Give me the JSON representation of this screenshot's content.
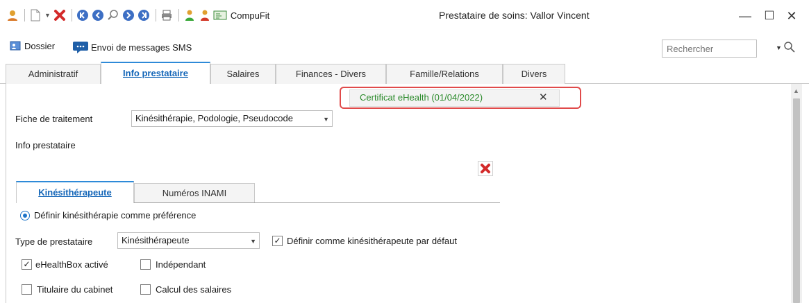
{
  "window": {
    "title": "Prestataire de soins: Vallor Vincent",
    "minimize": "—",
    "maximize": "☐",
    "close": "✕"
  },
  "toolbar": {
    "compufit_label": "CompuFit",
    "icons": [
      "person-search-icon",
      "new-document-icon",
      "delete-icon",
      "first-record-icon",
      "previous-record-icon",
      "search-icon",
      "next-record-icon",
      "last-record-icon",
      "print-icon",
      "person-green-icon",
      "person-red-icon",
      "compufit-icon"
    ]
  },
  "actions": {
    "dossier_label": "Dossier",
    "sms_label": "Envoi de messages SMS"
  },
  "search": {
    "placeholder": "Rechercher"
  },
  "tabs": [
    {
      "label": "Administratif"
    },
    {
      "label": "Info prestataire"
    },
    {
      "label": "Salaires"
    },
    {
      "label": "Finances - Divers"
    },
    {
      "label": "Famille/Relations"
    },
    {
      "label": "Divers"
    }
  ],
  "certificate": {
    "text": "Certificat eHealth (01/04/2022)",
    "close": "✕"
  },
  "form": {
    "fiche_label": "Fiche de traitement",
    "fiche_value": "Kinésithérapie, Podologie, Pseudocode",
    "info_label": "Info prestataire"
  },
  "subtabs": [
    {
      "label": "Kinésithérapeute"
    },
    {
      "label": "Numéros INAMI"
    }
  ],
  "kine": {
    "radio_label": "Définir kinésithérapie comme préférence",
    "type_label": "Type de prestataire",
    "type_value": "Kinésithérapeute",
    "default_label": "Définir comme kinésithérapeute par défaut",
    "default_checked": true,
    "ehealthbox_label": "eHealthBox activé",
    "ehealthbox_checked": true,
    "independant_label": "Indépendant",
    "independant_checked": false,
    "titulaire_label": "Titulaire du cabinet",
    "titulaire_checked": false,
    "salaires_label": "Calcul des salaires",
    "salaires_checked": false
  },
  "colors": {
    "accent": "#1466b8",
    "certificate_text": "#2a8a2a",
    "highlight_border": "#e04a4a"
  }
}
